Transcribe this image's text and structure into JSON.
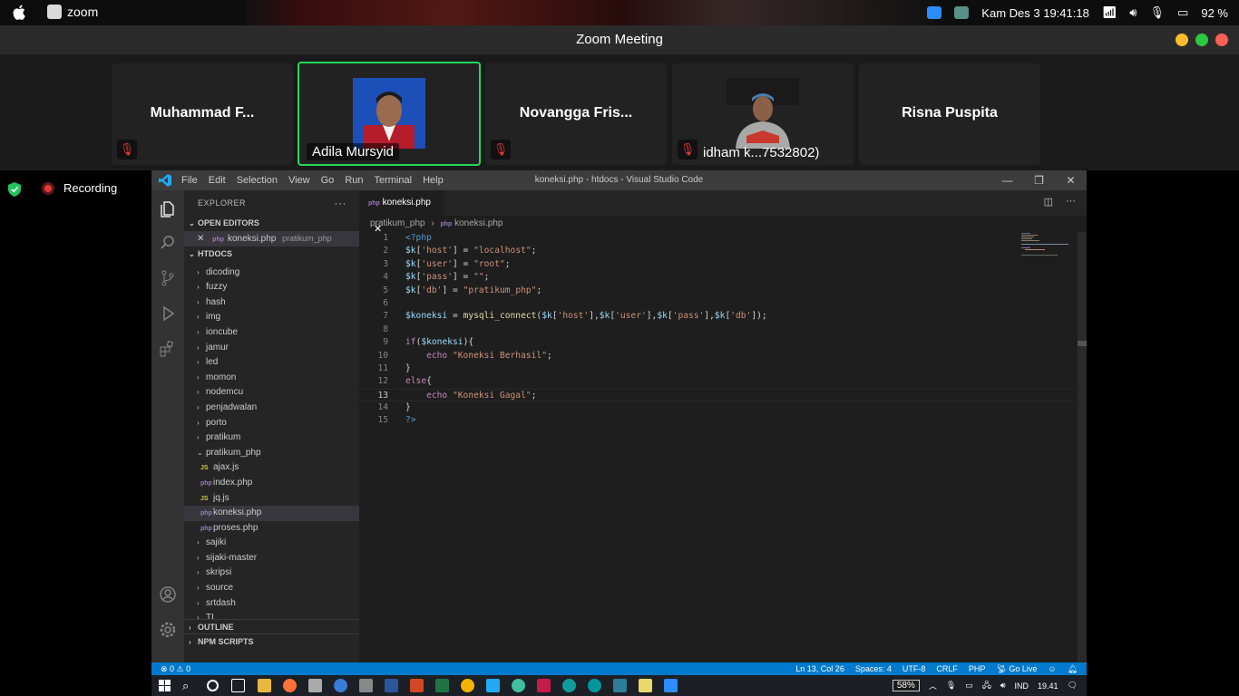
{
  "menubar": {
    "app_name": "zoom",
    "datetime": "Kam Des 3  19:41:18",
    "battery": "92 %"
  },
  "zoom": {
    "window_title": "Zoom Meeting",
    "participants": [
      {
        "name": "Muhammad F...",
        "muted": true,
        "video": false,
        "active": false
      },
      {
        "name": "Adila Mursyid",
        "muted": false,
        "video": true,
        "active": true
      },
      {
        "name": "Novangga Fris...",
        "muted": true,
        "video": false,
        "active": false
      },
      {
        "name": "idham k...7532802)",
        "muted": true,
        "video": true,
        "active": false
      },
      {
        "name": "Risna Puspita",
        "muted": false,
        "video": false,
        "active": false
      }
    ],
    "recording_label": "Recording"
  },
  "vscode": {
    "menus": [
      "File",
      "Edit",
      "Selection",
      "View",
      "Go",
      "Run",
      "Terminal",
      "Help"
    ],
    "window_title": "koneksi.php - htdocs - Visual Studio Code",
    "explorer_title": "EXPLORER",
    "open_editors_label": "OPEN EDITORS",
    "open_editor": {
      "name": "koneksi.php",
      "folder": "pratikum_php"
    },
    "htdocs_label": "HTDOCS",
    "tree": [
      {
        "type": "folder",
        "name": "dicoding",
        "open": false
      },
      {
        "type": "folder",
        "name": "fuzzy",
        "open": false
      },
      {
        "type": "folder",
        "name": "hash",
        "open": false
      },
      {
        "type": "folder",
        "name": "img",
        "open": false
      },
      {
        "type": "folder",
        "name": "ioncube",
        "open": false
      },
      {
        "type": "folder",
        "name": "jamur",
        "open": false
      },
      {
        "type": "folder",
        "name": "led",
        "open": false
      },
      {
        "type": "folder",
        "name": "momon",
        "open": false
      },
      {
        "type": "folder",
        "name": "nodemcu",
        "open": false
      },
      {
        "type": "folder",
        "name": "penjadwalan",
        "open": false
      },
      {
        "type": "folder",
        "name": "porto",
        "open": false
      },
      {
        "type": "folder",
        "name": "pratikum",
        "open": false
      },
      {
        "type": "folder",
        "name": "pratikum_php",
        "open": true
      },
      {
        "type": "file",
        "name": "ajax.js",
        "lang": "js"
      },
      {
        "type": "file",
        "name": "index.php",
        "lang": "php"
      },
      {
        "type": "file",
        "name": "jq.js",
        "lang": "js"
      },
      {
        "type": "file",
        "name": "koneksi.php",
        "lang": "php",
        "selected": true
      },
      {
        "type": "file",
        "name": "proses.php",
        "lang": "php"
      },
      {
        "type": "folder",
        "name": "sajiki",
        "open": false
      },
      {
        "type": "folder",
        "name": "sijaki-master",
        "open": false
      },
      {
        "type": "folder",
        "name": "skripsi",
        "open": false
      },
      {
        "type": "folder",
        "name": "source",
        "open": false
      },
      {
        "type": "folder",
        "name": "srtdash",
        "open": false
      },
      {
        "type": "folder",
        "name": "TI",
        "open": false
      }
    ],
    "outline_label": "OUTLINE",
    "npm_label": "NPM SCRIPTS",
    "tab_label": "koneksi.php",
    "breadcrumb": [
      "pratikum_php",
      "koneksi.php"
    ],
    "code_lines": [
      "<?php",
      "$k['host'] = \"localhost\";",
      "$k['user'] = \"root\";",
      "$k['pass'] = \"\";",
      "$k['db'] = \"pratikum_php\";",
      "",
      "$koneksi = mysqli_connect($k['host'],$k['user'],$k['pass'],$k['db']);",
      "",
      "if($koneksi){",
      "    echo \"Koneksi Berhasil\";",
      "}",
      "else{",
      "    echo \"Koneksi Gagal\";",
      "}",
      "?>"
    ],
    "current_line": 13,
    "status": {
      "problems": "⊗ 0 ⚠ 0",
      "position": "Ln 13, Col 26",
      "spaces": "Spaces: 4",
      "encoding": "UTF-8",
      "eol": "CRLF",
      "language": "PHP",
      "golive": "Go Live"
    }
  },
  "taskbar": {
    "battery": "58%",
    "lang": "IND",
    "time": "19.41"
  },
  "colors": {
    "accent_green": "#23d959",
    "vscode_blue": "#007acc",
    "record_red": "#e53935"
  }
}
